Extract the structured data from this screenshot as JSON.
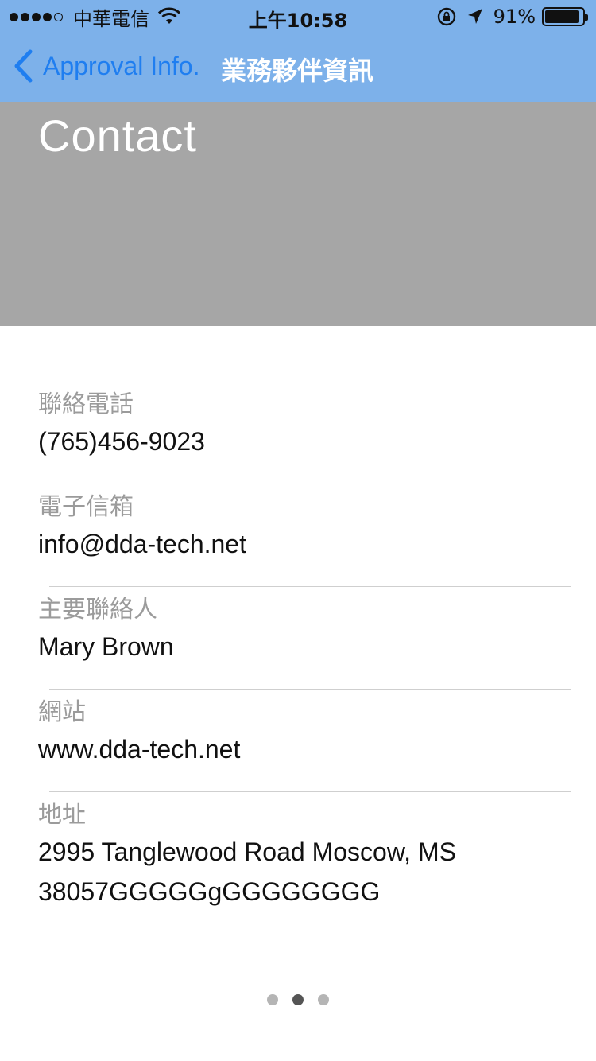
{
  "status_bar": {
    "carrier": "中華電信",
    "time": "上午10:58",
    "battery_percent": "91%",
    "battery_level": 0.91,
    "signal_bars_filled": 4,
    "signal_bars_total": 5,
    "icons": [
      "wifi-icon",
      "rotation-lock-icon",
      "location-arrow-icon",
      "battery-icon"
    ]
  },
  "nav": {
    "back_label": "Approval Info.",
    "title": "業務夥伴資訊",
    "back_color": "#1f7ef0",
    "bar_color": "#7db1ea"
  },
  "header": {
    "title": "Contact",
    "background": "#a6a6a6"
  },
  "fields": [
    {
      "label": "聯絡電話",
      "value": "(765)456-9023"
    },
    {
      "label": "電子信箱",
      "value": "info@dda-tech.net"
    },
    {
      "label": "主要聯絡人",
      "value": "Mary Brown"
    },
    {
      "label": "網站",
      "value": "www.dda-tech.net"
    },
    {
      "label": "地址",
      "value": "2995 Tanglewood Road Moscow, MS 38057GGGGGgGGGGGGGG"
    }
  ],
  "pager": {
    "total": 3,
    "current": 2
  }
}
